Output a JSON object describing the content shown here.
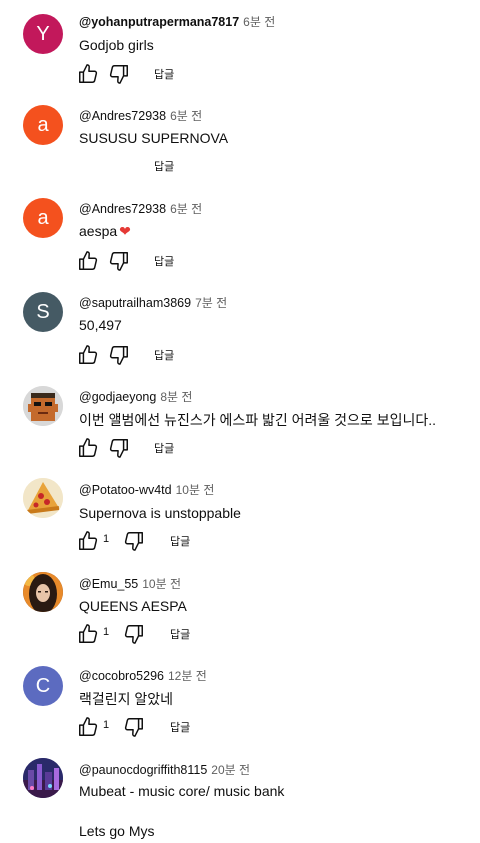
{
  "comments": [
    {
      "handle": "@yohanputrapermana7817",
      "time": "6분 전",
      "text": "Godjob girls",
      "likes": "",
      "reply": "답글",
      "avatar_letter": "Y",
      "avatar_color": "#c2185b"
    },
    {
      "handle": "@Andres72938",
      "time": "6분 전",
      "text": "SUSUSU SUPERNOVA",
      "likes": "",
      "reply": "답글",
      "avatar_letter": "a",
      "avatar_color": "#f4511e"
    },
    {
      "handle": "@Andres72938",
      "time": "6분 전",
      "text": "aespa",
      "likes": "",
      "reply": "답글",
      "avatar_letter": "a",
      "avatar_color": "#f4511e"
    },
    {
      "handle": "@saputrailham3869",
      "time": "7분 전",
      "text": "50,497",
      "likes": "",
      "reply": "답글",
      "avatar_letter": "S",
      "avatar_color": "#455a64"
    },
    {
      "handle": "@godjaeyong",
      "time": "8분 전",
      "text": "이번 앨범에선 뉴진스가 에스파 밟긴 어려울 것으로 보입니다..",
      "likes": "",
      "reply": "답글",
      "avatar_letter": "",
      "avatar_color": "#c46a2c"
    },
    {
      "handle": "@Potatoo-wv4td",
      "time": "10분 전",
      "text": "Supernova is unstoppable",
      "likes": "1",
      "reply": "답글",
      "avatar_letter": "",
      "avatar_color": "#d9a03a"
    },
    {
      "handle": "@Emu_55",
      "time": "10분 전",
      "text": "QUEENS AESPA",
      "likes": "1",
      "reply": "답글",
      "avatar_letter": "",
      "avatar_color": "#5a3020"
    },
    {
      "handle": "@cocobro5296",
      "time": "12분 전",
      "text": "랙걸린지 알았네",
      "likes": "1",
      "reply": "답글",
      "avatar_letter": "C",
      "avatar_color": "#5c6bc0"
    },
    {
      "handle": "@paunocdogriffith8115",
      "time": "20분 전",
      "text": "Mubeat - music core/ music bank",
      "text2": "Lets go Mys",
      "likes": "",
      "reply": "",
      "avatar_letter": "",
      "avatar_color": "#2a2a6a"
    }
  ],
  "icons": {
    "like": "thumb-up-icon",
    "dislike": "thumb-down-icon",
    "heart": "red-heart-emoji"
  },
  "colors": {
    "heart": "#e53935",
    "meta_gray": "#606060"
  }
}
